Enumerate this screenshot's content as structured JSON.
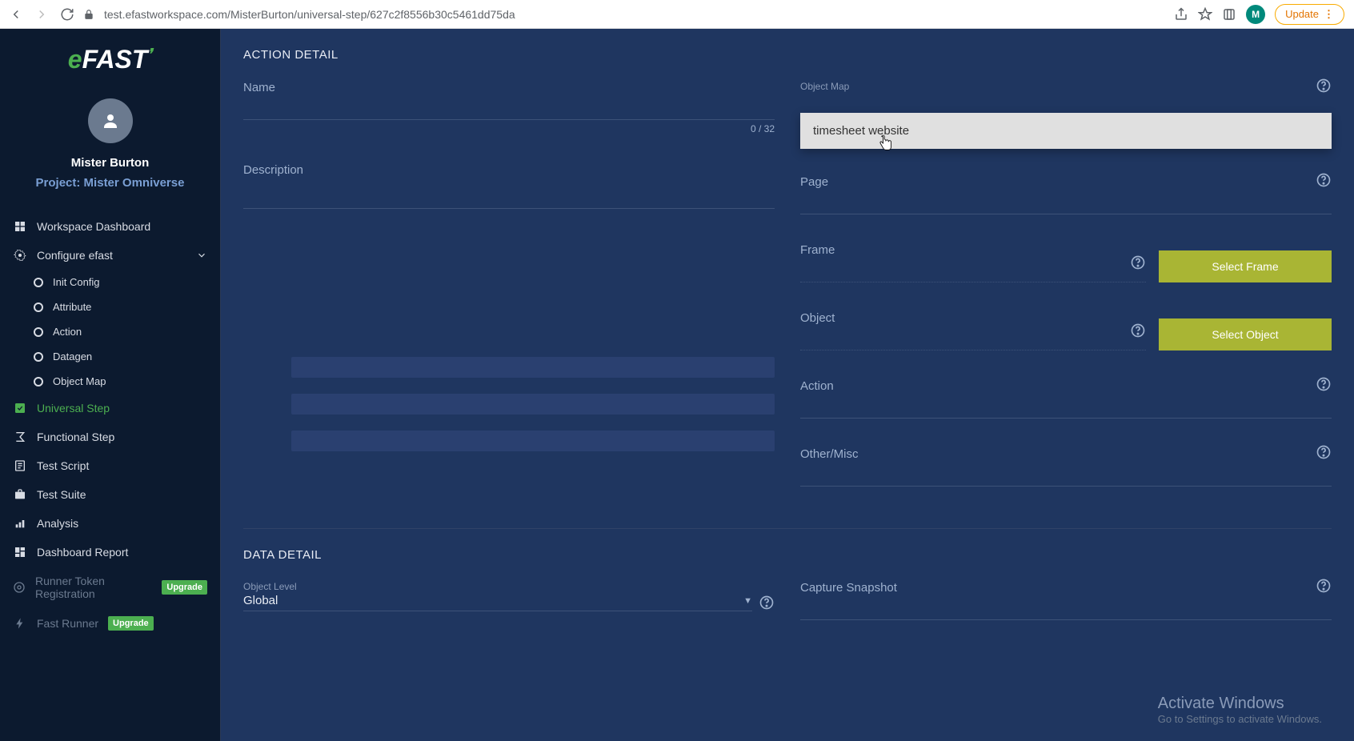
{
  "browser": {
    "url": "test.efastworkspace.com/MisterBurton/universal-step/627c2f8556b30c5461dd75da",
    "update_label": "Update",
    "avatar_letter": "M"
  },
  "logo": {
    "prefix": "e",
    "main": "FAST"
  },
  "profile": {
    "name": "Mister Burton",
    "project": "Project: Mister Omniverse"
  },
  "sidebar": {
    "workspace_dashboard": "Workspace Dashboard",
    "configure_efast": "Configure efast",
    "sub": {
      "init_config": "Init Config",
      "attribute": "Attribute",
      "action": "Action",
      "datagen": "Datagen",
      "object_map": "Object Map"
    },
    "universal_step": "Universal Step",
    "functional_step": "Functional Step",
    "test_script": "Test Script",
    "test_suite": "Test Suite",
    "analysis": "Analysis",
    "dashboard_report": "Dashboard Report",
    "runner_token_registration": "Runner Token Registration",
    "fast_runner": "Fast Runner",
    "upgrade": "Upgrade"
  },
  "section": {
    "action_detail": "ACTION DETAIL",
    "data_detail": "DATA DETAIL"
  },
  "fields": {
    "name_label": "Name",
    "name_count": "0 / 32",
    "description_label": "Description",
    "object_map_label": "Object Map",
    "page_label": "Page",
    "frame_label": "Frame",
    "object_label": "Object",
    "action_label": "Action",
    "other_misc_label": "Other/Misc",
    "object_level_label": "Object Level",
    "object_level_value": "Global",
    "capture_snapshot_label": "Capture Snapshot"
  },
  "buttons": {
    "select_frame": "Select Frame",
    "select_object": "Select Object"
  },
  "dropdown": {
    "option1": "timesheet website"
  },
  "windows": {
    "title": "Activate Windows",
    "subtitle": "Go to Settings to activate Windows."
  }
}
